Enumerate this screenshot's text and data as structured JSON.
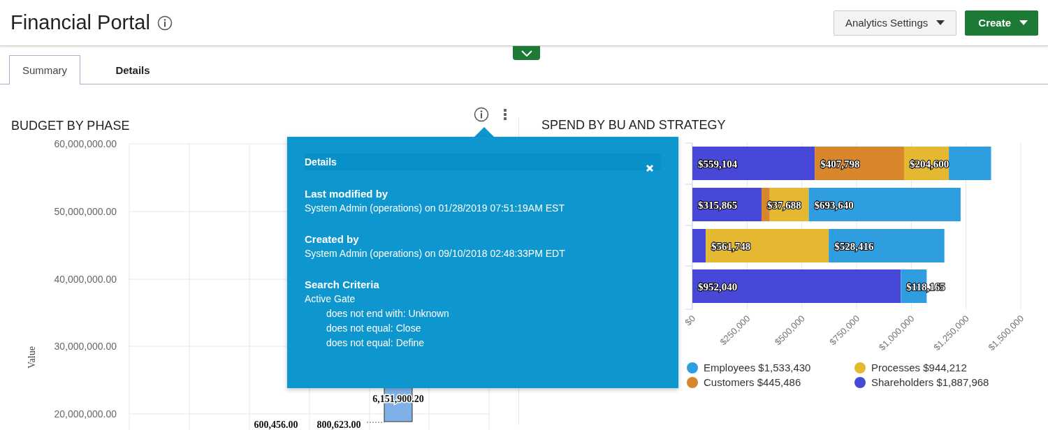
{
  "header": {
    "title": "Financial Portal",
    "buttons": [
      {
        "label": "Analytics Settings",
        "kind": "secondary"
      },
      {
        "label": "Create",
        "kind": "primary"
      }
    ]
  },
  "tabs": [
    {
      "label": "Summary",
      "selected": true
    },
    {
      "label": "Details",
      "selected": false
    }
  ],
  "budget_panel": {
    "title": "BUDGET BY PHASE",
    "y_axis_label": "Value",
    "y_ticks": [
      "60,000,000.00",
      "50,000,000.00",
      "40,000,000.00",
      "30,000,000.00",
      "20,000,000.00"
    ],
    "bar_labels": [
      "600,456.00",
      "800,623.00",
      "6,151,900.20"
    ]
  },
  "details_popup": {
    "title": "Details",
    "sections": [
      {
        "heading": "Last modified by",
        "lines": [
          {
            "text": "System Admin (operations) on 01/28/2019 07:51:19AM EST",
            "indented": false
          }
        ]
      },
      {
        "heading": "Created by",
        "lines": [
          {
            "text": "System Admin (operations) on 09/10/2018 02:48:33PM EDT",
            "indented": false
          }
        ]
      },
      {
        "heading": "Search Criteria",
        "lines": [
          {
            "text": "Active Gate",
            "indented": false
          },
          {
            "text": "does not end with: Unknown",
            "indented": true
          },
          {
            "text": "does not equal: Close",
            "indented": true
          },
          {
            "text": "does not equal: Define",
            "indented": true
          }
        ]
      }
    ]
  },
  "spend_panel": {
    "title": "SPEND BY BU AND STRATEGY",
    "chart_data": {
      "type": "bar",
      "orientation": "horizontal",
      "stacked": true,
      "grid": true,
      "xlim": [
        0,
        1500000
      ],
      "xticks": [
        {
          "value": 0,
          "label": "$0"
        },
        {
          "value": 250000,
          "label": "$250,000"
        },
        {
          "value": 500000,
          "label": "$500,000"
        },
        {
          "value": 750000,
          "label": "$750,000"
        },
        {
          "value": 1000000,
          "label": "$1,000,000"
        },
        {
          "value": 1250000,
          "label": "$1,250,000"
        },
        {
          "value": 1500000,
          "label": "$1,500,000"
        }
      ],
      "series": [
        {
          "name": "Shareholders",
          "color": "#4848d8",
          "values": [
            559104,
            315865,
            61000,
            952040
          ],
          "value_labels": [
            "$559,104",
            "$315,865",
            null,
            "$952,040"
          ]
        },
        {
          "name": "Customers",
          "color": "#d8862c",
          "values": [
            407798,
            37688,
            0,
            0
          ],
          "value_labels": [
            "$407,798",
            "$37,688",
            null,
            null
          ]
        },
        {
          "name": "Processes",
          "color": "#e4b830",
          "values": [
            204600,
            178000,
            561748,
            0
          ],
          "value_labels": [
            "$204,600",
            null,
            "$561,748",
            null
          ]
        },
        {
          "name": "Employees",
          "color": "#2f9ee0",
          "values": [
            193000,
            693640,
            528416,
            118165
          ],
          "value_labels": [
            null,
            "$693,640",
            "$528,416",
            "$118,165"
          ]
        }
      ]
    },
    "legend_totals": [
      "$1,533,430",
      "$944,212",
      "$445,486",
      "$1,887,968"
    ]
  }
}
